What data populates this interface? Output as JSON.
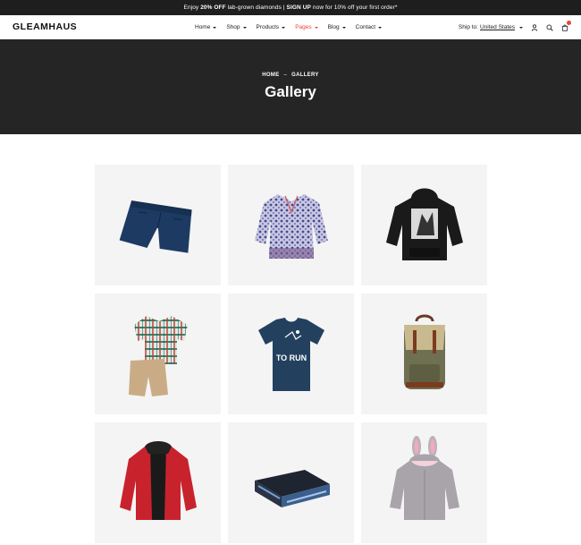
{
  "announcement": {
    "prefix": "Enjoy",
    "highlight": "20% OFF",
    "middle": "lab-grown diamonds |",
    "cta": "SIGN UP",
    "suffix": "now for 10% off your first order*"
  },
  "header": {
    "logo": "GLEAMHAUS",
    "nav": [
      {
        "label": "Home",
        "active": false
      },
      {
        "label": "Shop",
        "active": false
      },
      {
        "label": "Products",
        "active": false
      },
      {
        "label": "Pages",
        "active": true
      },
      {
        "label": "Blog",
        "active": false
      },
      {
        "label": "Contact",
        "active": false
      }
    ],
    "ship_label": "Ship to:",
    "ship_country": "United States",
    "icons": [
      "user-icon",
      "search-icon",
      "cart-icon"
    ],
    "accent_color": "#e4473a"
  },
  "hero": {
    "crumb_home": "HOME",
    "crumb_sep": "–",
    "crumb_current": "GALLERY",
    "title": "Gallery"
  },
  "gallery": {
    "items": [
      {
        "name": "navy-shorts"
      },
      {
        "name": "floral-blouse"
      },
      {
        "name": "black-graphic-hoodie"
      },
      {
        "name": "kids-plaid-shirt-and-shorts"
      },
      {
        "name": "navy-run-tshirt",
        "print_text": "TO RUN"
      },
      {
        "name": "canvas-backpack"
      },
      {
        "name": "red-jacket"
      },
      {
        "name": "folded-boxer-shorts"
      },
      {
        "name": "bunny-ear-hoodie"
      }
    ]
  }
}
